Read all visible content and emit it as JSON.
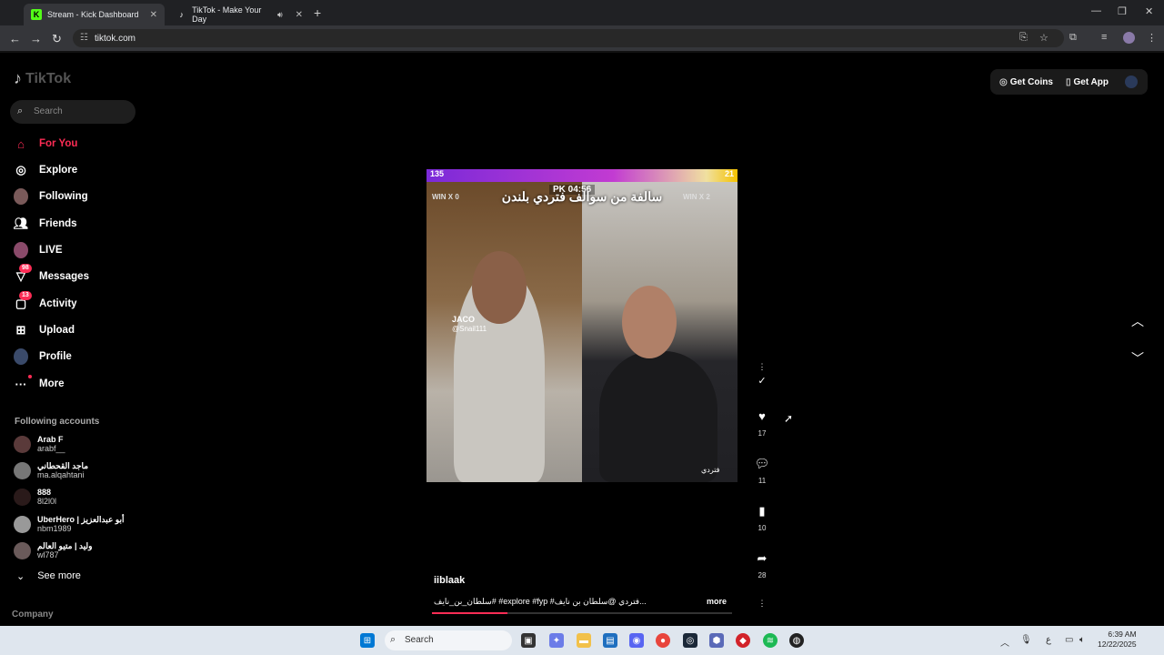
{
  "browser": {
    "tabs": [
      {
        "title": "Stream - Kick Dashboard",
        "favicon": "K"
      },
      {
        "title": "TikTok - Make Your Day",
        "favicon": "♪"
      }
    ],
    "url": "tiktok.com"
  },
  "tiktok": {
    "logo": "TikTok",
    "search_placeholder": "Search",
    "nav": [
      {
        "label": "For You",
        "icon": "home-icon"
      },
      {
        "label": "Explore",
        "icon": "compass-icon"
      },
      {
        "label": "Following",
        "icon": "avatar"
      },
      {
        "label": "Friends",
        "icon": "friends-icon"
      },
      {
        "label": "LIVE",
        "icon": "avatar"
      },
      {
        "label": "Messages",
        "icon": "inbox-icon",
        "badge": "98"
      },
      {
        "label": "Activity",
        "icon": "activity-icon",
        "badge": "13"
      },
      {
        "label": "Upload",
        "icon": "upload-icon"
      },
      {
        "label": "Profile",
        "icon": "avatar"
      },
      {
        "label": "More",
        "icon": "more-icon"
      }
    ],
    "following_title": "Following accounts",
    "accounts": [
      {
        "name": "Arab F",
        "handle": "arabf__"
      },
      {
        "name": "ماجد القحطاني",
        "handle": "ma.alqahtani"
      },
      {
        "name": "888",
        "handle": "8l2l0l"
      },
      {
        "name": "UberHero | أبو عبدالعزيز",
        "handle": "nbm1989"
      },
      {
        "name": "وليد | متيو العالم",
        "handle": "wl787"
      }
    ],
    "see_more": "See more",
    "company": "Company",
    "get_coins": "Get Coins",
    "get_app": "Get App",
    "video": {
      "top_left_score": "135",
      "top_right_score": "21",
      "pk_timer": "PK 04:56",
      "win_left": "WIN  X 0",
      "win_right": "WIN  X 2",
      "caption": "سالفة من سوالف فتردي بلندن",
      "left_tag_name": "JACO",
      "left_tag_handle": "@Snail111",
      "right_tag": "فتردي"
    },
    "counts": {
      "likes": "17",
      "comments": "11",
      "saves": "10",
      "shares": "28"
    },
    "author": "iiblaak",
    "description": "سلطان_بن_نايف# #explore #fyp #فتردي @سلطان بن نايف... ",
    "more": "more",
    "progress": 0.25
  },
  "taskbar": {
    "search": "Search",
    "time": "6:39 AM",
    "date": "12/22/2025",
    "lang": "ع"
  },
  "colors": {
    "accent": "#fe2c55"
  }
}
